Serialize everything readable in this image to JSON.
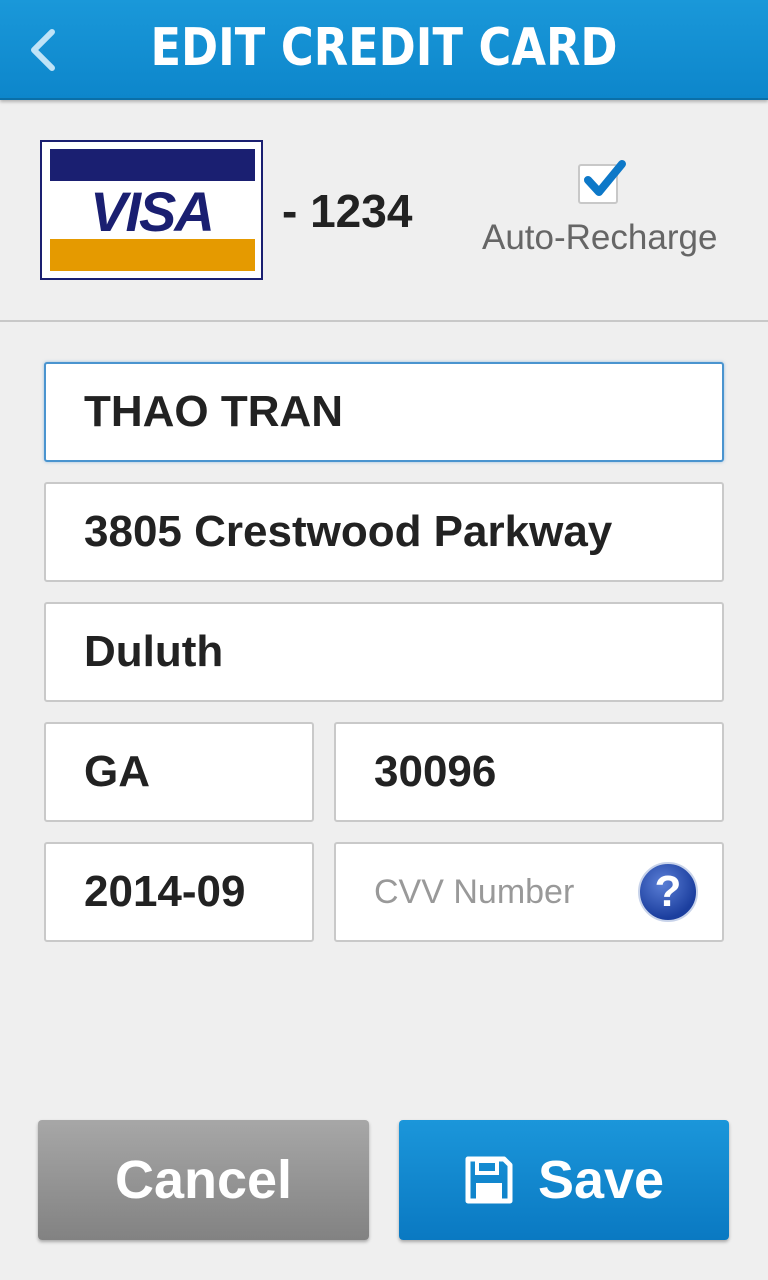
{
  "header": {
    "title": "EDIT CREDIT CARD",
    "back_icon": "chevron-left-icon"
  },
  "card": {
    "brand": "VISA",
    "last4": "- 1234",
    "auto_recharge": {
      "label": "Auto-Recharge",
      "checked": true
    }
  },
  "form": {
    "name": "THAO TRAN",
    "address": "3805 Crestwood Parkway",
    "city": "Duluth",
    "state": "GA",
    "zip": "30096",
    "expiry": "2014-09",
    "cvv_placeholder": "CVV Number",
    "help_icon": "?"
  },
  "buttons": {
    "cancel": "Cancel",
    "save": "Save",
    "save_icon": "floppy-disk-icon"
  },
  "colors": {
    "accent": "#0d86cb",
    "visa_blue": "#1a1f71",
    "visa_gold": "#e59a00",
    "cancel_gray": "#959595"
  }
}
